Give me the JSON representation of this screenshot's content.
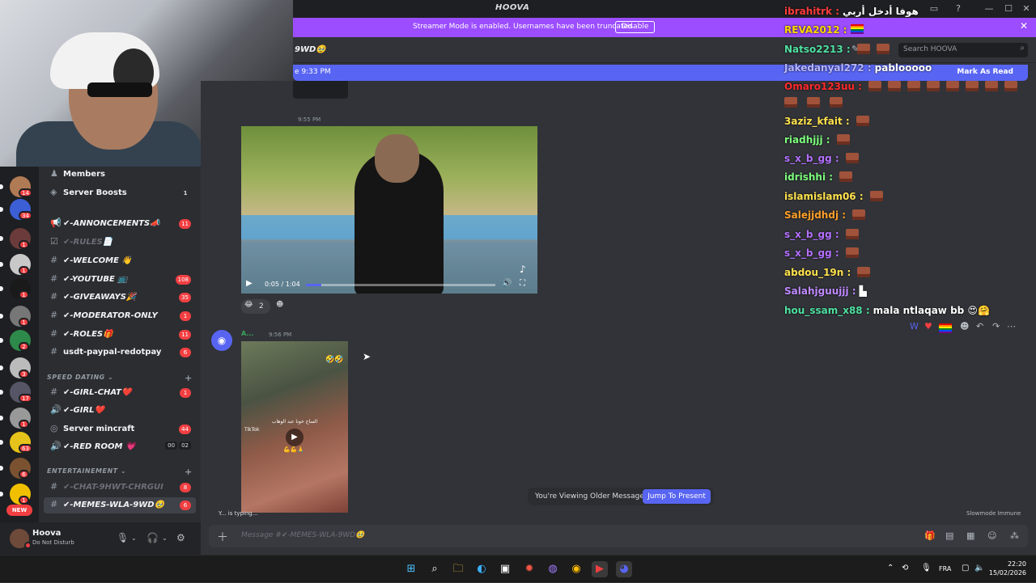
{
  "window": {
    "title": "HOOVA"
  },
  "banner": {
    "text": "Streamer Mode is enabled. Usernames have been truncated.",
    "button": "Disable"
  },
  "header": {
    "channel_name": "9WD🥹",
    "search_placeholder": "Search HOOVA"
  },
  "new_messages": {
    "left": "e 9:33 PM",
    "right": "Mark As Read"
  },
  "sidebar": {
    "channels": [
      {
        "label": "Members",
        "icon": "members-icon",
        "count": ""
      },
      {
        "label": "Server Boosts",
        "icon": "boost-icon",
        "count": "1"
      },
      {
        "label": "✔-ANNONCEMENTS📣",
        "icon": "announce-icon",
        "count": "11"
      },
      {
        "label": "✔-RULES📄",
        "icon": "rules-icon",
        "count": ""
      },
      {
        "label": "✔-WELCOME 👋",
        "icon": "hash-icon",
        "count": ""
      },
      {
        "label": "✔-YOUTUBE 📺",
        "icon": "hash-icon",
        "count": "108"
      },
      {
        "label": "✔-GIVEAWAYS🎉",
        "icon": "hash-icon",
        "count": "35"
      },
      {
        "label": "✔-MODERATOR-ONLY",
        "icon": "hash-icon",
        "count": "1"
      },
      {
        "label": "✔-ROLES🎁",
        "icon": "hash-icon",
        "count": "11"
      },
      {
        "label": "usdt-paypal-redotpay",
        "icon": "hash-icon",
        "count": "6"
      }
    ],
    "category1": "SPEED DATING",
    "channels2": [
      {
        "label": "✔-GIRL-CHAT❤️",
        "icon": "hash-icon",
        "count": "1"
      },
      {
        "label": "✔-GIRL❤️",
        "icon": "speaker-icon",
        "count": ""
      },
      {
        "label": "Server mincraft",
        "icon": "stage-icon",
        "count": "44"
      },
      {
        "label": "✔-RED ROOM 💗",
        "icon": "speaker-icon",
        "vc1": "00",
        "vc2": "02"
      }
    ],
    "category2": "ENTERTAINEMENT",
    "channels3": [
      {
        "label": "✔-CHAT-9HWT-CHRGUI",
        "icon": "hash-icon",
        "count": "8"
      },
      {
        "label": "✔-MEMES-WLA-9WD🥹",
        "icon": "hash-icon",
        "count": "6"
      }
    ]
  },
  "servers": {
    "badges": [
      "14",
      "34",
      "1",
      "1",
      "1",
      "1",
      "2",
      "3",
      "17",
      "1",
      "63",
      "6",
      "1"
    ],
    "new_label": "NEW"
  },
  "user": {
    "name": "Hoova",
    "status": "Do Not Disturb"
  },
  "messages": {
    "ts1": "9:55 PM",
    "video1_time": "0:05 / 1:04",
    "video1_progress": 0.08,
    "reaction_count": "2",
    "author2": "A...",
    "ts2": "9:56 PM",
    "video2_caption": "الساح خونا عبد الوهاب",
    "video2_watermark": "TikTok",
    "older_text": "You're Viewing Older Messages",
    "jump_button": "Jump To Present",
    "typing": "Y... is typing...",
    "slowmode": "Slowmode Immune",
    "placeholder": "Message #✔-MEMES-WLA-9WD🥹"
  },
  "overlay": {
    "lines": [
      {
        "user": "ibrahitrk",
        "color": "#ff3b3b",
        "msg": "هوفا أدخل أربي"
      },
      {
        "user": "REVA2012",
        "color": "#ffd700",
        "msg": "",
        "flag": true
      },
      {
        "user": "Natso2213",
        "color": "#4fe0a0",
        "msg": "",
        "emotes": 2
      },
      {
        "user": "Jakedanyal272",
        "color": "#b7b7ff",
        "msg": "pablooooo"
      },
      {
        "user": "Omaro123uu",
        "color": "#ff2a2a",
        "msg": "",
        "emotes": 8
      },
      {
        "user": "3aziz_kfait",
        "color": "#ffe14d",
        "msg": "",
        "emotes": 1
      },
      {
        "user": "riadhjjj",
        "color": "#7dff7d",
        "msg": "",
        "emotes": 1
      },
      {
        "user": "s_x_b_gg",
        "color": "#b470ff",
        "msg": "",
        "emotes": 1
      },
      {
        "user": "idrishhi",
        "color": "#7dff7d",
        "msg": "",
        "emotes": 1
      },
      {
        "user": "islamislam06",
        "color": "#ffe14d",
        "msg": "",
        "emotes": 1
      },
      {
        "user": "Salejjdhdj",
        "color": "#ff9f2a",
        "msg": "",
        "emotes": 1
      },
      {
        "user": "s_x_b_gg",
        "color": "#b470ff",
        "msg": "",
        "emotes": 1
      },
      {
        "user": "s_x_b_gg",
        "color": "#b470ff",
        "msg": "",
        "emotes": 1
      },
      {
        "user": "abdou_19n",
        "color": "#ffe14d",
        "msg": "",
        "emotes": 1
      },
      {
        "user": "Salahjguujjj",
        "color": "#c08aff",
        "msg": "▙"
      },
      {
        "user": "hou_ssam_x88",
        "color": "#4fe0a0",
        "msg": "mala ntlaqaw bb 😍🤗"
      }
    ]
  },
  "taskbar": {
    "language": "FRA",
    "time": "22:20",
    "date": "15/02/2026"
  }
}
